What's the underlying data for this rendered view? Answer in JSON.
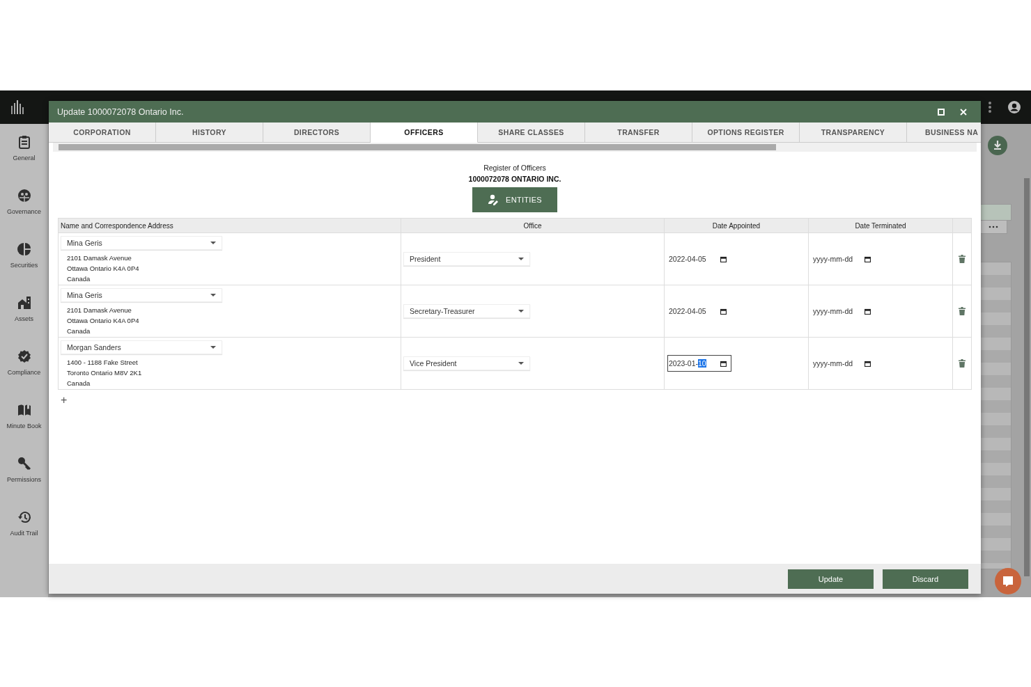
{
  "sidebar": {
    "items": [
      {
        "label": "General"
      },
      {
        "label": "Governance"
      },
      {
        "label": "Securities"
      },
      {
        "label": "Assets"
      },
      {
        "label": "Compliance"
      },
      {
        "label": "Minute Book"
      },
      {
        "label": "Permissions"
      },
      {
        "label": "Audit Trail"
      }
    ]
  },
  "dialog": {
    "title": "Update 1000072078 Ontario Inc.",
    "tabs": [
      {
        "label": "CORPORATION",
        "selected": false
      },
      {
        "label": "HISTORY",
        "selected": false
      },
      {
        "label": "DIRECTORS",
        "selected": false
      },
      {
        "label": "OFFICERS",
        "selected": true
      },
      {
        "label": "SHARE CLASSES",
        "selected": false
      },
      {
        "label": "TRANSFER",
        "selected": false
      },
      {
        "label": "OPTIONS REGISTER",
        "selected": false
      },
      {
        "label": "TRANSPARENCY",
        "selected": false
      },
      {
        "label": "BUSINESS NA",
        "selected": false
      }
    ],
    "heading": "Register of Officers",
    "company": "1000072078 ONTARIO INC.",
    "entities_button": "ENTITIES",
    "table": {
      "columns": [
        "Name and Correspondence Address",
        "Office",
        "Date Appointed",
        "Date Terminated"
      ],
      "rows": [
        {
          "name": "Mina Geris",
          "address": [
            "2101 Damask Avenue",
            "Ottawa Ontario K4A 0P4",
            "Canada"
          ],
          "office": "President",
          "date_appointed": {
            "value": "2022-04-05",
            "focused": false
          },
          "date_terminated": {
            "placeholder": "yyyy-mm-dd"
          }
        },
        {
          "name": "Mina Geris",
          "address": [
            "2101 Damask Avenue",
            "Ottawa Ontario K4A 0P4",
            "Canada"
          ],
          "office": "Secretary-Treasurer",
          "date_appointed": {
            "value": "2022-04-05",
            "focused": false
          },
          "date_terminated": {
            "placeholder": "yyyy-mm-dd"
          }
        },
        {
          "name": "Morgan Sanders",
          "address": [
            "1400 - 1188 Fake Street",
            "Toronto Ontario M8V 2K1",
            "Canada"
          ],
          "office": "Vice President",
          "date_appointed": {
            "value": "2023-01-",
            "highlighted": "10",
            "focused": true
          },
          "date_terminated": {
            "placeholder": "yyyy-mm-dd"
          }
        }
      ]
    },
    "add_button": "+",
    "buttons": [
      "Update",
      "Discard"
    ]
  }
}
